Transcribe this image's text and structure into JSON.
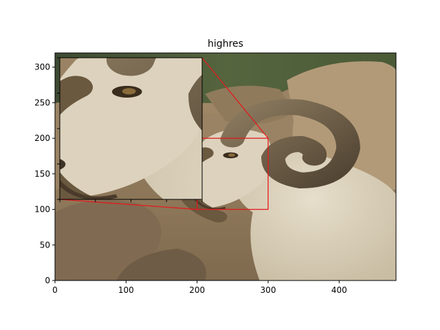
{
  "chart_data": {
    "type": "image",
    "title": "highres",
    "xlabel": "",
    "ylabel": "",
    "xlim": [
      0,
      480
    ],
    "ylim": [
      0,
      320
    ],
    "x_ticks": [
      0,
      100,
      200,
      300,
      400
    ],
    "y_ticks": [
      0,
      50,
      100,
      150,
      200,
      250,
      300
    ],
    "grid": false,
    "zoom_region": {
      "x": [
        200,
        300
      ],
      "y": [
        100,
        200
      ]
    },
    "inset": {
      "xlim": [
        200,
        300
      ],
      "ylim": [
        100,
        200
      ],
      "tick_labels_visible": false,
      "location": "upper-left"
    },
    "indicator_color": "#e31a1c"
  }
}
